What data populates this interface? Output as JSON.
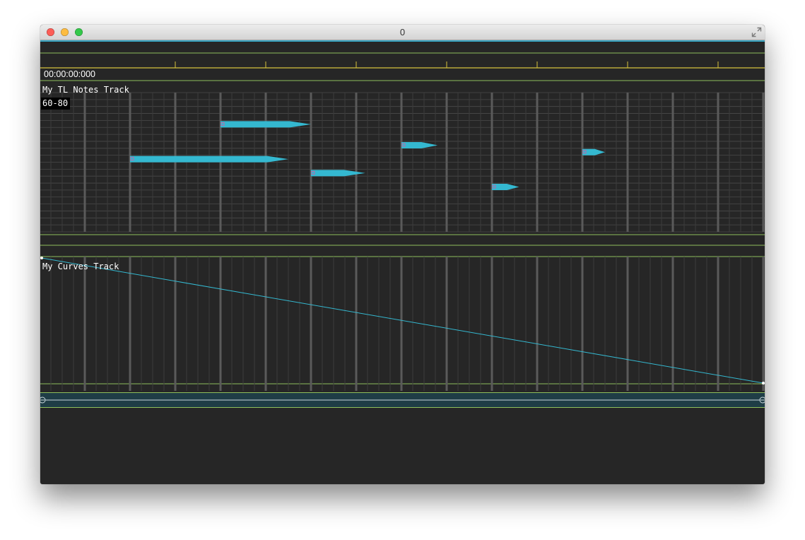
{
  "window": {
    "title": "0",
    "buttons": {
      "close_color": "#fc5d57",
      "minimize_color": "#fdbc40",
      "zoom_color": "#34c84a"
    }
  },
  "timeline": {
    "timecode": "00:00:00:000",
    "ruler_ticks": 8,
    "accent_color": "#d6c23c",
    "track_border_color": "#8fbf5c"
  },
  "notes_track": {
    "label": "My TL Notes Track",
    "range_badge": "60-80",
    "note_color": "#34b8d0",
    "pitch_rows": 20,
    "notes": [
      {
        "start": 1.0,
        "length": 3.5,
        "row": 9
      },
      {
        "start": 3.0,
        "length": 2.0,
        "row": 4
      },
      {
        "start": 5.0,
        "length": 1.2,
        "row": 11
      },
      {
        "start": 7.0,
        "length": 0.8,
        "row": 7
      },
      {
        "start": 9.0,
        "length": 0.6,
        "row": 13
      },
      {
        "start": 11.0,
        "length": 0.5,
        "row": 8
      }
    ]
  },
  "curves_track": {
    "label": "My Curves Track",
    "curve_color": "#34b8d0",
    "points": [
      {
        "t": 0,
        "v": 1
      },
      {
        "t": 16,
        "v": 0
      }
    ]
  },
  "icons": {
    "fullscreen": "fullscreen-arrows-icon",
    "scroll_left": "scroll-handle-left-icon",
    "scroll_right": "scroll-handle-right-icon"
  }
}
